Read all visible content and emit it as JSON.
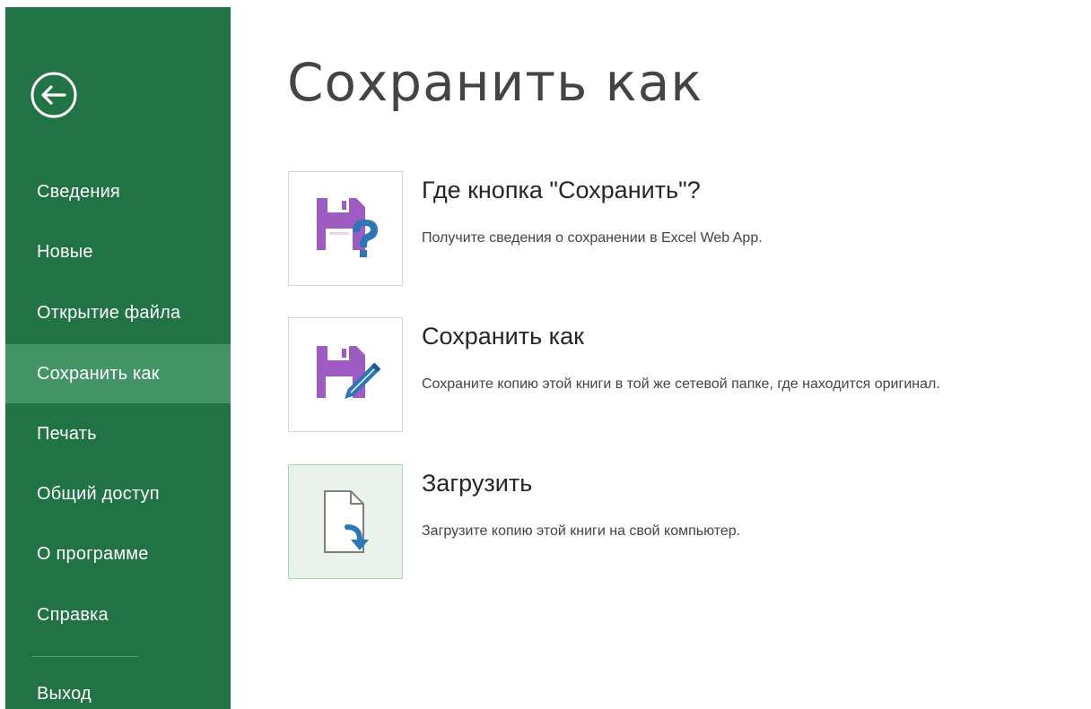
{
  "sidebar": {
    "back_icon": "arrow-left-circle-icon",
    "items": [
      {
        "label": "Сведения",
        "selected": false
      },
      {
        "label": "Новые",
        "selected": false
      },
      {
        "label": "Открытие файла",
        "selected": false
      },
      {
        "label": "Сохранить как",
        "selected": true
      },
      {
        "label": "Печать",
        "selected": false
      },
      {
        "label": "Общий доступ",
        "selected": false
      },
      {
        "label": "О программе",
        "selected": false
      },
      {
        "label": "Справка",
        "selected": false
      }
    ],
    "exit_label": "Выход"
  },
  "main": {
    "title": "Сохранить как",
    "options": [
      {
        "title": "Где кнопка \"Сохранить\"?",
        "description": "Получите сведения о сохранении в Excel Web App.",
        "icon": "floppy-question-icon"
      },
      {
        "title": "Сохранить как",
        "description": "Сохраните копию этой книги в той же сетевой папке, где находится оригинал.",
        "icon": "floppy-pencil-icon"
      },
      {
        "title": "Загрузить",
        "description": "Загрузите копию этой книги на свой компьютер.",
        "icon": "document-download-icon"
      }
    ]
  },
  "colors": {
    "sidebar_bg": "#217346",
    "sidebar_selected": "#439467",
    "icon_purple": "#9e5cc2",
    "icon_blue": "#2e75b6"
  }
}
